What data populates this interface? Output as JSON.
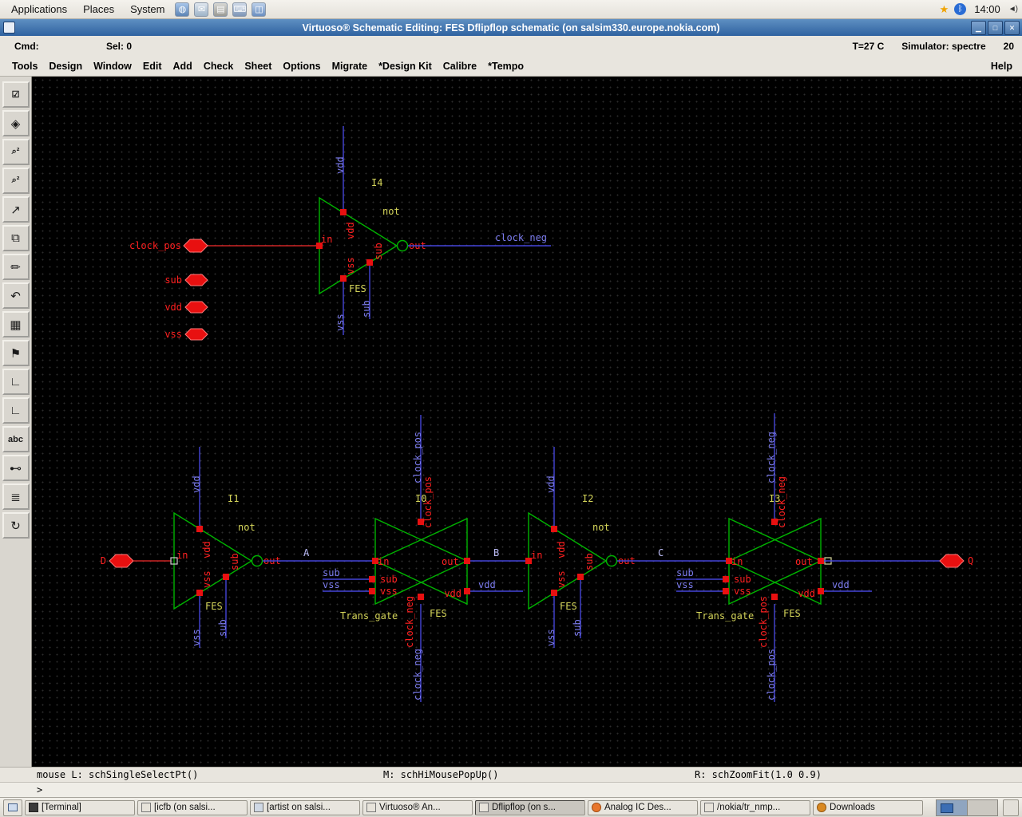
{
  "panel": {
    "menus": [
      "Applications",
      "Places",
      "System"
    ],
    "launchers": [
      {
        "name": "web-browser-icon",
        "glyph": "◍",
        "style": "background:linear-gradient(#a8c6ea,#5c84b4)"
      },
      {
        "name": "email-icon",
        "glyph": "✉",
        "style": "background:linear-gradient(#dfe6ee,#9fb4c8)"
      },
      {
        "name": "printer-icon",
        "glyph": "▤",
        "style": "background:linear-gradient(#d8d8d4,#9a9a94)"
      },
      {
        "name": "terminal-icon",
        "glyph": "⌨",
        "style": "background:linear-gradient(#cfd9e8,#7e96b6)"
      },
      {
        "name": "files-icon",
        "glyph": "◫",
        "style": "background:linear-gradient(#bcd0ea,#6b8fc0)"
      }
    ],
    "status": {
      "star": "★",
      "bluetooth": "ᛒ",
      "volume": "◄)"
    },
    "clock": "14:00"
  },
  "window": {
    "title": "Virtuoso® Schematic Editing: FES Dflipflop schematic (on salsim330.europe.nokia.com)",
    "controls": {
      "minimize": "▁",
      "maximize": "□",
      "close": "✕"
    }
  },
  "cmd_bar": {
    "cmd": "Cmd:",
    "sel": "Sel: 0",
    "temp": "T=27 C",
    "simulator": "Simulator: spectre",
    "count": "20"
  },
  "menu_bar": {
    "items": [
      "Tools",
      "Design",
      "Window",
      "Edit",
      "Add",
      "Check",
      "Sheet",
      "Options",
      "Migrate",
      "*Design Kit",
      "Calibre",
      "*Tempo"
    ],
    "help": "Help"
  },
  "toolbar": {
    "icons": [
      {
        "name": "check-save-icon",
        "glyph": "☑"
      },
      {
        "name": "save-icon",
        "glyph": "◈"
      },
      {
        "name": "zoom-in-2x-icon",
        "glyph": "⌕²"
      },
      {
        "name": "zoom-out-2x-icon",
        "glyph": "⌕²"
      },
      {
        "name": "stretch-icon",
        "glyph": "↗"
      },
      {
        "name": "copy-icon",
        "glyph": "⧉"
      },
      {
        "name": "delete-icon",
        "glyph": "✏"
      },
      {
        "name": "undo-icon",
        "glyph": "↶"
      },
      {
        "name": "yank-icon",
        "glyph": "▦"
      },
      {
        "name": "instance-icon",
        "glyph": "⚑"
      },
      {
        "name": "narrow-wire-icon",
        "glyph": "∟"
      },
      {
        "name": "wide-wire-icon",
        "glyph": "∟"
      },
      {
        "name": "wire-name-icon",
        "glyph": "abc"
      },
      {
        "name": "pin-icon",
        "glyph": "⊷"
      },
      {
        "name": "property-icon",
        "glyph": "≣"
      },
      {
        "name": "repeat-icon",
        "glyph": "↻"
      }
    ]
  },
  "canvas": {
    "text": {
      "vdd": "vdd",
      "vss": "vss",
      "sub": "sub",
      "fes": "FES",
      "in": "in",
      "out": "out",
      "not": "not",
      "trans_gate": "Trans_gate",
      "clock_pos": "clock_pos",
      "clock_neg": "clock_neg",
      "i0": "I0",
      "i1": "I1",
      "i2": "I2",
      "i3": "I3",
      "i4": "I4",
      "a": "A",
      "b": "B",
      "c": "C",
      "d": "D",
      "q": "Q"
    }
  },
  "mouse_bar": {
    "left": "mouse L: schSingleSelectPt()",
    "middle": "M: schHiMousePopUp()",
    "right": "R: schZoomFit(1.0 0.9)"
  },
  "prompt": {
    "symbol": ">"
  },
  "taskbar": {
    "buttons": [
      {
        "label": "[Terminal]",
        "icon_style": "background:#3a3a3a;border:1px solid #222"
      },
      {
        "label": "[icfb (on salsi...",
        "icon_style": "background:#e7e3da;border:1px solid #777"
      },
      {
        "label": "[artist on salsi...",
        "icon_style": "background:#cfd8e4;border:1px solid #777"
      },
      {
        "label": "Virtuoso® An...",
        "icon_style": "background:#e7e3da;border:1px solid #777"
      },
      {
        "label": "Dflipflop (on s...",
        "icon_style": "background:#e7e3da;border:1px solid #777",
        "active": true
      },
      {
        "label": "Analog IC Des...",
        "icon_style": "background:#e8762c;border-radius:50%;border:1px solid #a04a10"
      },
      {
        "label": "/nokia/tr_nmp...",
        "icon_style": "background:#e7e3da;border:1px solid #777"
      },
      {
        "label": "Downloads",
        "icon_style": "background:#d98922;border-radius:50%;border:1px solid #93560f"
      }
    ]
  }
}
